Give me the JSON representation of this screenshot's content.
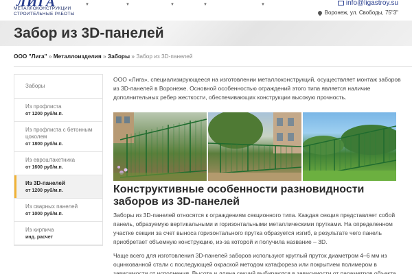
{
  "header": {
    "logo_mark": "ЛИГА",
    "logo_line1": "МЕТАЛЛОКОНСТРУКЦИИ",
    "logo_line2": "СТРОИТЕЛЬНЫЕ РАБОТЫ",
    "email": "info@ligastroy.su",
    "address": "Воронеж, ул. Свободы, 75\"3\""
  },
  "page": {
    "title": "Забор из 3D-панелей"
  },
  "breadcrumb": {
    "items": [
      "ООО \"Лига\"",
      "Металлоизделия",
      "Заборы"
    ],
    "separator": " » ",
    "current": "Забор из 3D-панелей"
  },
  "sidebar": {
    "items": [
      {
        "name": "Заборы",
        "price": ""
      },
      {
        "name": "Из профлиста",
        "price": "от 1200 руб/м.п."
      },
      {
        "name": "Из профлиста с бетонным цоколем",
        "price": "от 1800 руб/м.п."
      },
      {
        "name": "Из евроштакетника",
        "price": "от 1600 руб/м.п."
      },
      {
        "name": "Из 3D-панелей",
        "price": "от 1200 руб/м.п."
      },
      {
        "name": "Из сварных панелей",
        "price": "от 1000 руб/м.п."
      },
      {
        "name": "Из кирпича",
        "price": "инд. расчет"
      }
    ]
  },
  "content": {
    "intro": "ООО «Лига», специализирующееся на изготовлении металлоконструкций, осуществляет монтаж заборов из 3D-панелей в Воронеже. Основной особенностью ограждений этого типа является наличие дополнительных ребер жесткости, обеспечивающих конструкции высокую прочность.",
    "heading": "Конструктивные особенности разновидности заборов из 3D-панелей",
    "para1": "Заборы из 3D-панелей относятся к ограждениям секционного типа. Каждая секция представляет собой панель, образуемую вертикальными и горизонтальными металлическими прутками. На определенном участке секции за счет выноса горизонтального прутка образуется изгиб, в результате чего панель приобретает объемную конструкцию, из-за которой и получила название – 3D.",
    "para2": "Чаще всего для изготовления 3D-панелей заборов используют круглый пруток диаметром 4–6 мм из оцинкованной стали с последующей окраской методом катафореза или покрытием полимером в зависимости от исполнения. Высота и длина секций выбираются в зависимости от параметров объекта."
  },
  "colors": {
    "accent": "#f2b233",
    "brand": "#2a3f8f",
    "fence": "#1f6b2e"
  }
}
